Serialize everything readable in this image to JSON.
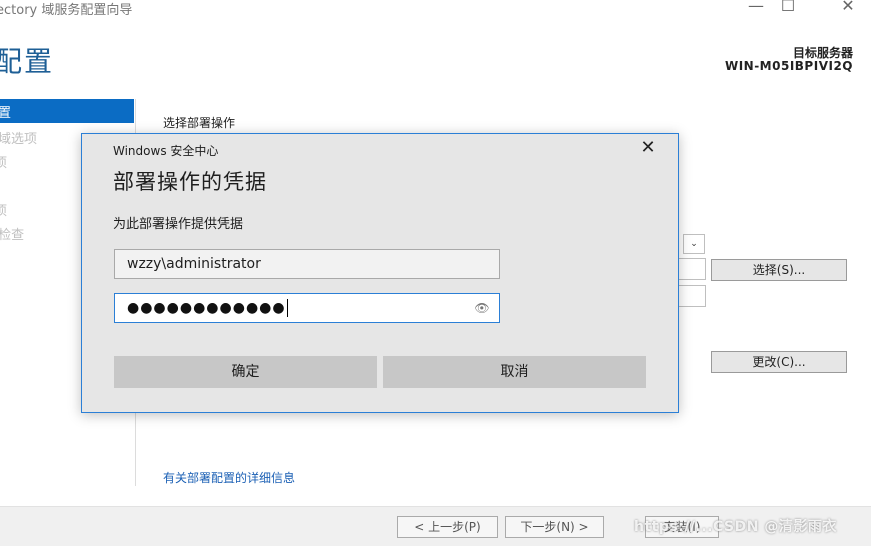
{
  "window": {
    "title": "ectory 域服务配置向导",
    "minimize_glyph": "—",
    "maximize_glyph": "☐",
    "close_glyph": "✕"
  },
  "header": {
    "heading": "配置",
    "target_label": "目标服务器",
    "target_name": "WIN-M05IBPIVI2Q"
  },
  "sidebar": {
    "items": [
      {
        "label": "置",
        "selected": true
      },
      {
        "label": "域选项",
        "selected": false
      },
      {
        "label": "项",
        "selected": false
      },
      {
        "label": "项",
        "selected": false
      },
      {
        "label": "·检查",
        "selected": false
      }
    ]
  },
  "main": {
    "section_label": "选择部署操作",
    "combo_arrow": "⌄",
    "select_button": "选择(S)...",
    "change_button": "更改(C)...",
    "more_info_link": "有关部署配置的详细信息"
  },
  "footer": {
    "prev_button": "< 上一步(P)",
    "next_button": "下一步(N) >",
    "install_button": "安装(I)",
    "watermark": "https://...CSDN @清影雨衣"
  },
  "dialog": {
    "caption": "Windows 安全中心",
    "close_glyph": "✕",
    "title": "部署操作的凭据",
    "subtitle": "为此部署操作提供凭据",
    "username_value": "wzzy\\administrator",
    "password_mask": "●●●●●●●●●●●●",
    "reveal_icon_glyph": "👁",
    "ok_button": "确定",
    "cancel_button": "取消"
  },
  "colors": {
    "accent": "#0b6cc4",
    "heading_blue": "#1e5f96",
    "dialog_border": "#2b7fd6",
    "link": "#1a5fb4"
  }
}
